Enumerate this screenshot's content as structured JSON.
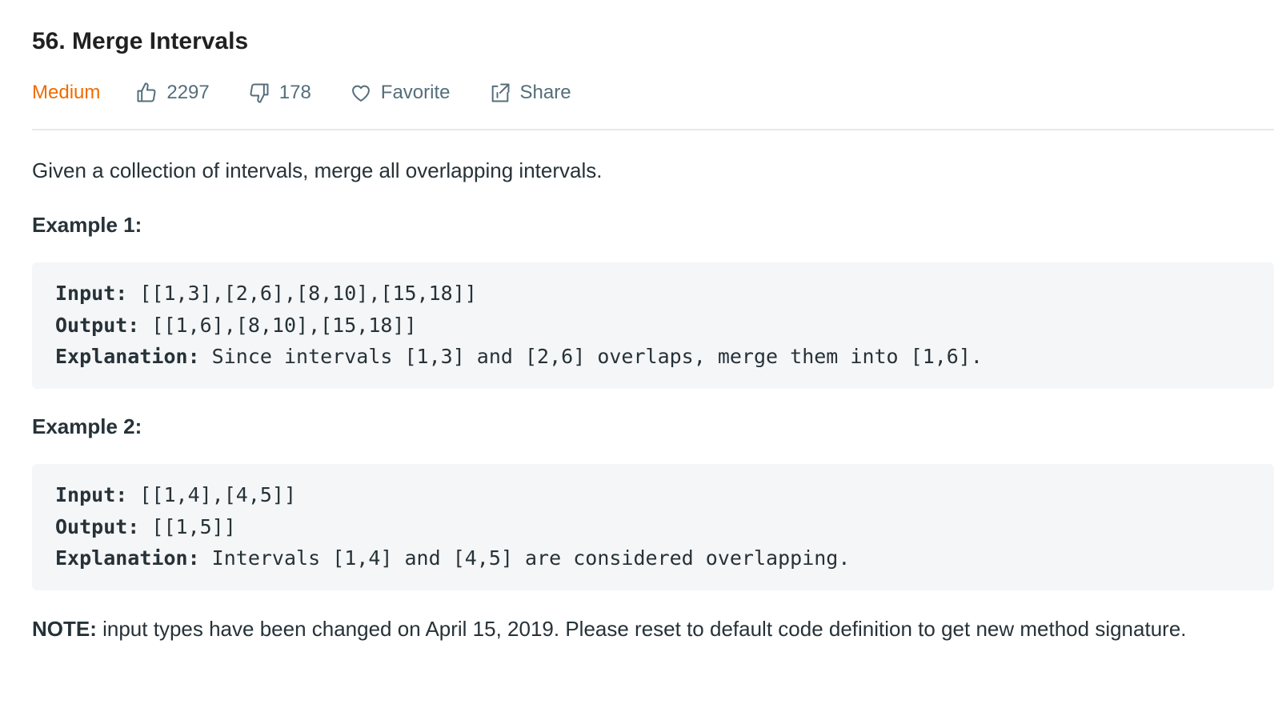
{
  "problem": {
    "title": "56. Merge Intervals",
    "difficulty": "Medium",
    "likes": "2297",
    "dislikes": "178",
    "favorite_label": "Favorite",
    "share_label": "Share"
  },
  "description": "Given a collection of intervals, merge all overlapping intervals.",
  "examples": [
    {
      "heading": "Example 1:",
      "input_label": "Input:",
      "input_value": " [[1,3],[2,6],[8,10],[15,18]]",
      "output_label": "Output:",
      "output_value": " [[1,6],[8,10],[15,18]]",
      "explanation_label": "Explanation:",
      "explanation_value": " Since intervals [1,3] and [2,6] overlaps, merge them into [1,6]."
    },
    {
      "heading": "Example 2:",
      "input_label": "Input:",
      "input_value": " [[1,4],[4,5]]",
      "output_label": "Output:",
      "output_value": " [[1,5]]",
      "explanation_label": "Explanation:",
      "explanation_value": " Intervals [1,4] and [4,5] are considered overlapping."
    }
  ],
  "note": {
    "label": "NOTE:",
    "text": " input types have been changed on April 15, 2019. Please reset to default code definition to get new method signature."
  },
  "colors": {
    "difficulty": "#ef6c00",
    "meta_text": "#546e7a",
    "code_bg": "#f5f6f8"
  },
  "icons": {
    "likes": "thumbs-up-icon",
    "dislikes": "thumbs-down-icon",
    "favorite": "heart-icon",
    "share": "share-icon"
  }
}
